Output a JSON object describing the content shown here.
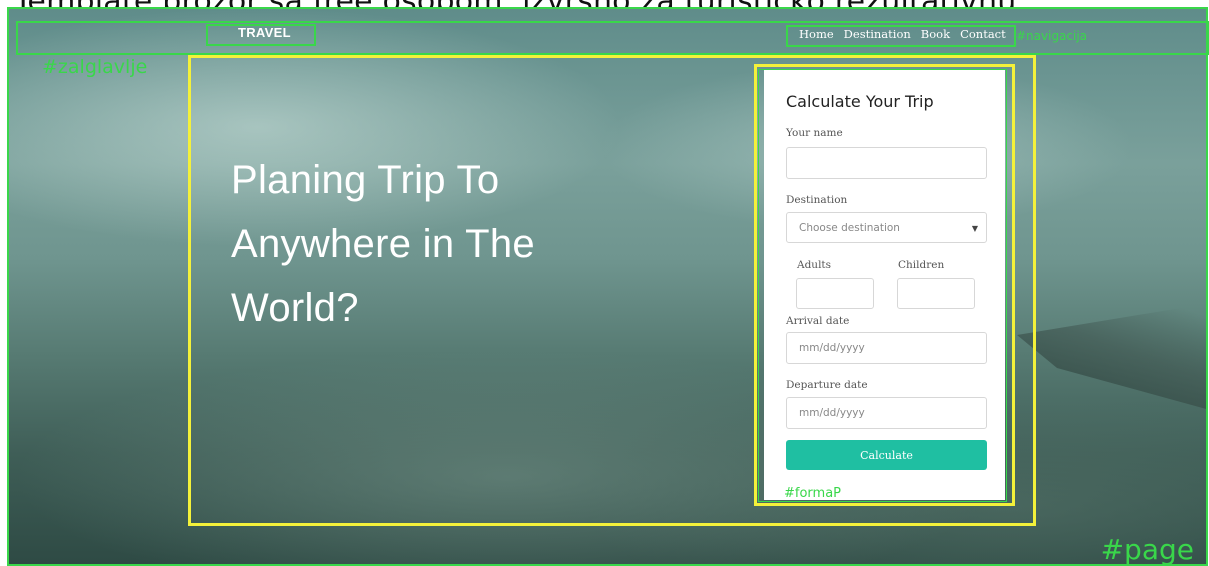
{
  "caption": "Template prozor sa free osobom, izvrsno za turisticko rezultativnu.",
  "annotations": {
    "page": "#page",
    "header": "#zalglavlje",
    "navigation": "#navigacija",
    "form": "#formaP"
  },
  "header": {
    "brand": "TRAVEL",
    "nav": [
      "Home",
      "Destination",
      "Book",
      "Contact"
    ]
  },
  "hero": {
    "lines": [
      "Planing Trip To",
      "Anywhere in The",
      "World?"
    ]
  },
  "form": {
    "title": "Calculate Your Trip",
    "name_label": "Your name",
    "name_value": "",
    "destination_label": "Destination",
    "destination_selected": "Choose destination",
    "adults_label": "Adults",
    "children_label": "Children",
    "arrival_label": "Arrival date",
    "arrival_placeholder": "mm/dd/yyyy",
    "departure_label": "Departure date",
    "departure_placeholder": "mm/dd/yyyy",
    "submit_label": "Calculate"
  },
  "colors": {
    "annotation_green": "#39d74a",
    "annotation_yellow": "#f4f13a",
    "button_teal": "#1fbfa2"
  }
}
